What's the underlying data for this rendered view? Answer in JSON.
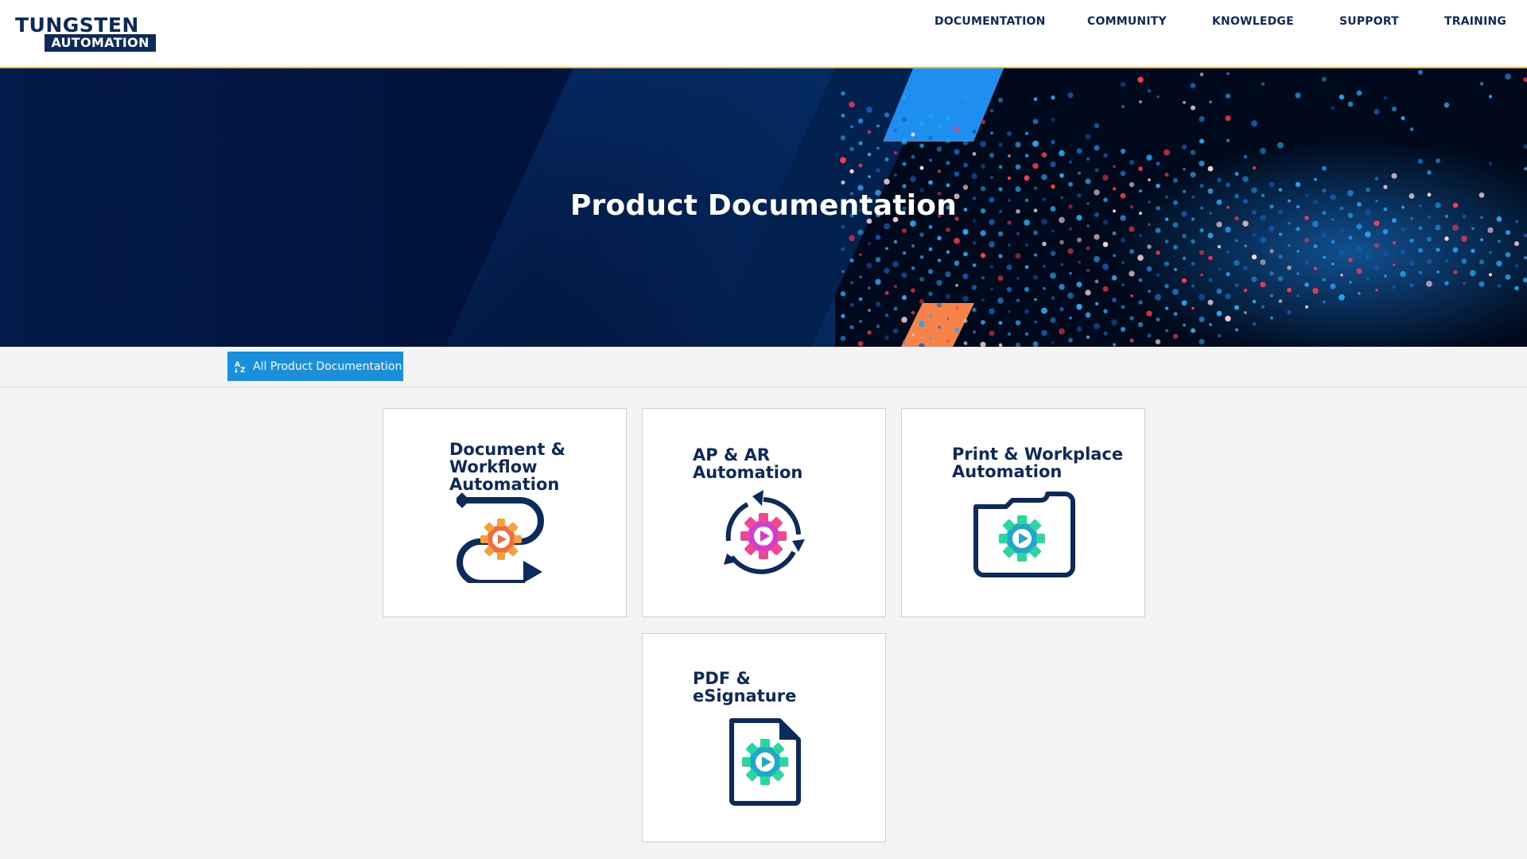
{
  "header": {
    "logo_line1": "TUNGSTEN",
    "logo_line2": "AUTOMATION",
    "nav": [
      {
        "label": "DOCUMENTATION"
      },
      {
        "label": "COMMUNITY"
      },
      {
        "label": "KNOWLEDGE"
      },
      {
        "label": "SUPPORT"
      },
      {
        "label": "TRAINING"
      }
    ]
  },
  "hero": {
    "title": "Product Documentation"
  },
  "filter": {
    "button_label": "All Product Documentation",
    "button_icon": "az-sort-icon"
  },
  "cards": [
    {
      "title": "Document &\nWorkflow\nAutomation",
      "icon": "workflow-gear-icon"
    },
    {
      "title": "AP & AR\nAutomation",
      "icon": "cycle-gear-icon"
    },
    {
      "title": "Print & Workplace\nAutomation",
      "icon": "folder-gear-icon"
    },
    {
      "title": "PDF &\neSignature",
      "icon": "document-gear-icon"
    }
  ],
  "colors": {
    "brand_navy": "#0d2a5c",
    "accent_blue": "#1a8fdc",
    "header_border": "#f3b33d"
  }
}
